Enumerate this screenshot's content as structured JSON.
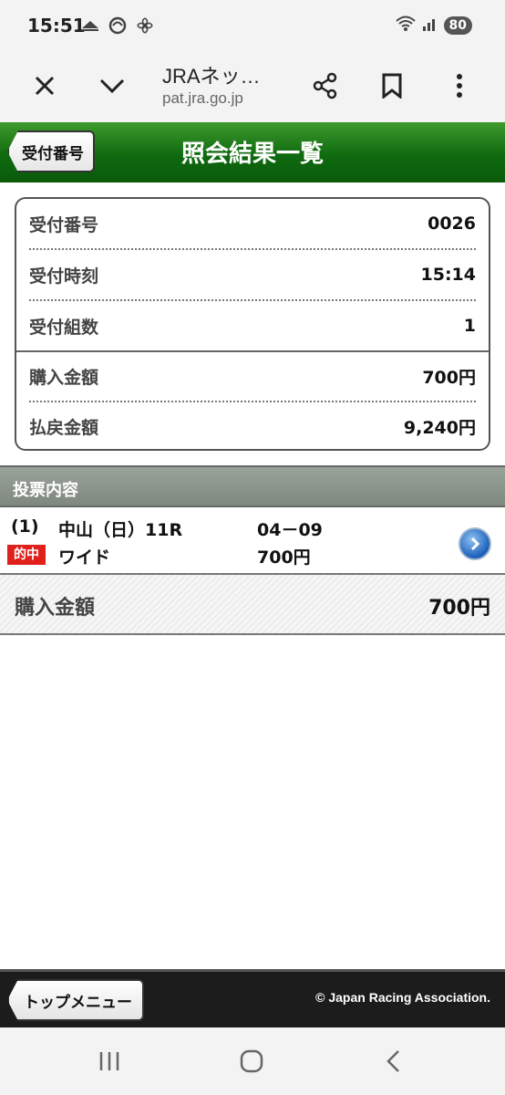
{
  "status_bar": {
    "time": "15:51",
    "left_icons": [
      "netkeiba-icon",
      "wind-icon",
      "fan-icon"
    ],
    "right_icons": [
      "wifi-icon",
      "signal-icon"
    ],
    "battery": "80"
  },
  "browser": {
    "title": "JRAネッ…",
    "url": "pat.jra.go.jp",
    "buttons": [
      "close-icon",
      "chevron-down-icon",
      "share-icon",
      "bookmark-icon",
      "more-icon"
    ]
  },
  "header": {
    "back_label": "受付番号",
    "title": "照会結果一覧",
    "color": "#1a7a16"
  },
  "summary": {
    "rows": [
      {
        "label": "受付番号",
        "value": "0026"
      },
      {
        "label": "受付時刻",
        "value": "15:14"
      },
      {
        "label": "受付組数",
        "value": "1"
      },
      {
        "label": "購入金額",
        "value": "700円"
      },
      {
        "label": "払戻金額",
        "value": "9,240円"
      }
    ]
  },
  "section": {
    "title": "投票内容"
  },
  "bet": {
    "index": "(1)",
    "race": "中山（日）11R",
    "numbers": "04－09",
    "hit_badge": "的中",
    "bet_type": "ワイド",
    "amount": "700円"
  },
  "total": {
    "label": "購入金額",
    "value": "700円"
  },
  "footer": {
    "top_menu_label": "トップメニュー",
    "copyright": "© Japan Racing Association."
  },
  "android_nav": [
    "recent-apps-icon",
    "home-icon",
    "back-icon"
  ]
}
